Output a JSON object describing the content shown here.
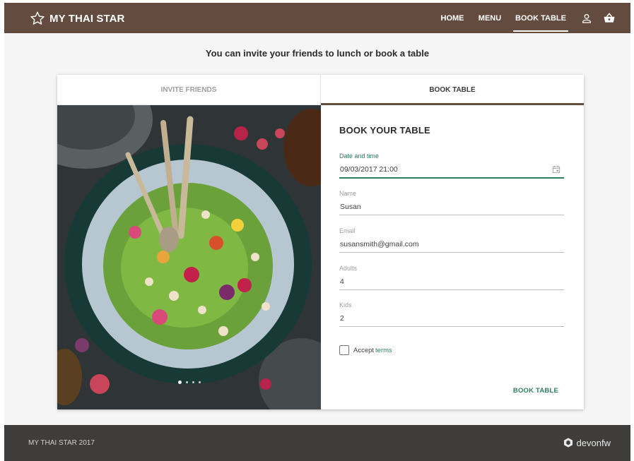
{
  "header": {
    "brand": "MY THAI STAR",
    "brand_icon": "star-outline-icon",
    "nav": [
      {
        "label": "HOME"
      },
      {
        "label": "MENU"
      },
      {
        "label": "BOOK TABLE",
        "active": true
      }
    ],
    "icons": [
      "user-icon",
      "basket-icon"
    ],
    "color": "#634c3f"
  },
  "subtitle": "You can invite your friends to lunch or book a table",
  "tabs": [
    {
      "label": "INVITE FRIENDS",
      "active": false
    },
    {
      "label": "BOOK TABLE",
      "active": true
    }
  ],
  "carousel": {
    "slides": 4,
    "active_slide": 1
  },
  "form": {
    "title": "BOOK  YOUR TABLE",
    "fields": [
      {
        "label": "Date and time",
        "value": "09/03/2017  21:00",
        "icon": "calendar-icon",
        "focused": true
      },
      {
        "label": "Name",
        "value": "Susan"
      },
      {
        "label": "Email",
        "value": "susansmith@gmail.com"
      },
      {
        "label": "Adults",
        "value": "4"
      },
      {
        "label": "Kids",
        "value": "2"
      }
    ],
    "accept": {
      "prefix": "Accept",
      "link": "terms",
      "checked": false
    },
    "submit_label": "BOOK TABLE",
    "accent_color": "#2e7d5b"
  },
  "footer": {
    "copyright": "MY THAI STAR 2017",
    "logo_text": "devonfw",
    "logo_icon": "devonfw-logo-icon"
  }
}
